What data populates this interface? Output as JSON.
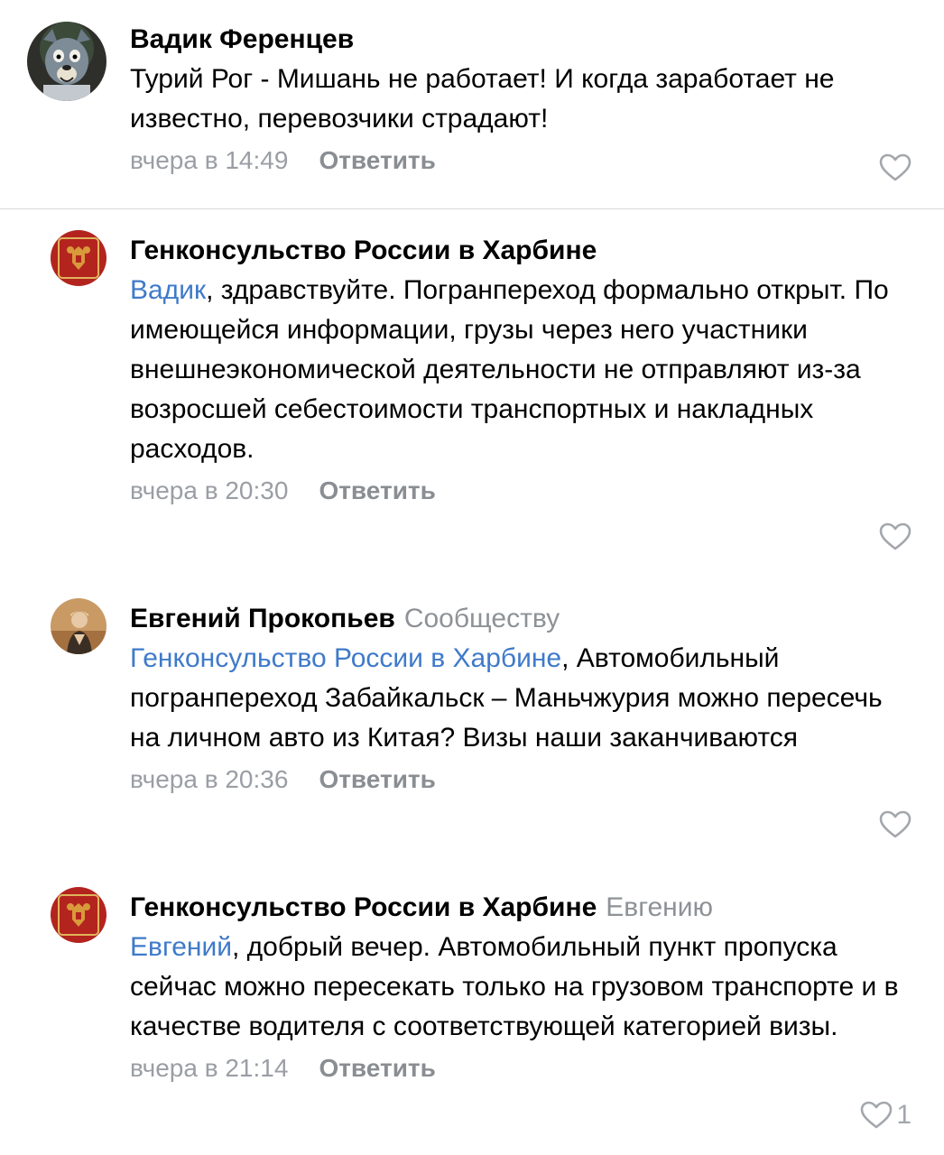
{
  "comments": [
    {
      "author": "Вадик Ференцев",
      "reply_to": "",
      "mention": "",
      "text": "Турий Рог - Мишань не работает! И когда заработает не известно, перевозчики страдают!",
      "time": "вчера в 14:49",
      "reply_label": "Ответить",
      "likes": "",
      "avatar_icon": "wolf-cartoon-avatar"
    },
    {
      "author": "Генконсульство России в Харбине",
      "reply_to": "",
      "mention": "Вадик",
      "text": ", здравствуйте. Погранпереход формально открыт. По имеющейся информации, грузы через него участники внешнеэкономической деятельности не отправляют из-за возросшей себестоимости транспортных и накладных расходов.",
      "time": "вчера в 20:30",
      "reply_label": "Ответить",
      "likes": "",
      "avatar_icon": "russian-emblem-avatar"
    },
    {
      "author": "Евгений Прокопьев",
      "reply_to": "Сообществу",
      "mention": "Генконсульство России в Харбине",
      "text": ", Автомобильный погранпереход Забайкальск – Маньчжурия можно пересечь на личном авто из Китая? Визы наши заканчиваются",
      "time": "вчера в 20:36",
      "reply_label": "Ответить",
      "likes": "",
      "avatar_icon": "user-photo-avatar"
    },
    {
      "author": "Генконсульство России в Харбине",
      "reply_to": "Евгению",
      "mention": "Евгений",
      "text": ", добрый вечер. Автомобильный пункт пропуска сейчас можно пересекать только на грузовом транспорте и в качестве водителя с соответствующей категорией визы.",
      "time": "вчера в 21:14",
      "reply_label": "Ответить",
      "likes": "1",
      "avatar_icon": "russian-emblem-avatar"
    }
  ],
  "colors": {
    "link": "#3f7ac9",
    "meta": "#9a9ea4",
    "divider": "#d6d8db"
  }
}
